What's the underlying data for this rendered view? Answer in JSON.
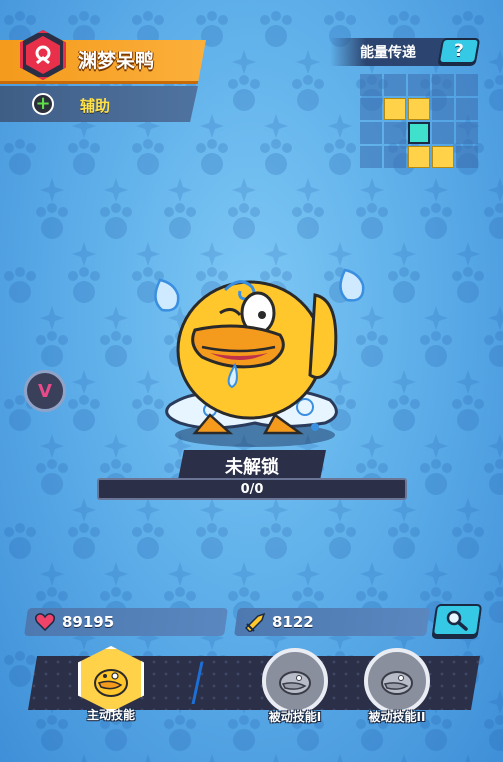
{
  "character": {
    "name": "渊梦呆鸭",
    "role": "辅助",
    "emblem_icon": "red-hexagon-ring-icon",
    "role_icon": "green-plus-icon"
  },
  "energy_transfer": {
    "label": "能量传递",
    "help_label": "?",
    "grid": [
      [
        0,
        0,
        0,
        0,
        0
      ],
      [
        0,
        1,
        1,
        0,
        0
      ],
      [
        0,
        0,
        2,
        0,
        0
      ],
      [
        0,
        0,
        1,
        1,
        0
      ]
    ]
  },
  "badge": {
    "label": "V"
  },
  "unlock": {
    "status_label": "未解锁",
    "progress_text": "0/0",
    "progress_fraction": 0
  },
  "stats": {
    "hp": "89195",
    "attack": "8122",
    "hp_icon": "heart-icon",
    "attack_icon": "sword-icon"
  },
  "skills": [
    {
      "label": "主动技能",
      "type": "active"
    },
    {
      "label": "被动技能I",
      "type": "passive"
    },
    {
      "label": "被动技能II",
      "type": "passive"
    }
  ],
  "colors": {
    "accent_orange": "#f49a1c",
    "accent_cyan": "#35c9e6",
    "accent_yellow": "#ffd24a",
    "panel_dark": "#2b3048",
    "role_text": "#ffe14a"
  }
}
